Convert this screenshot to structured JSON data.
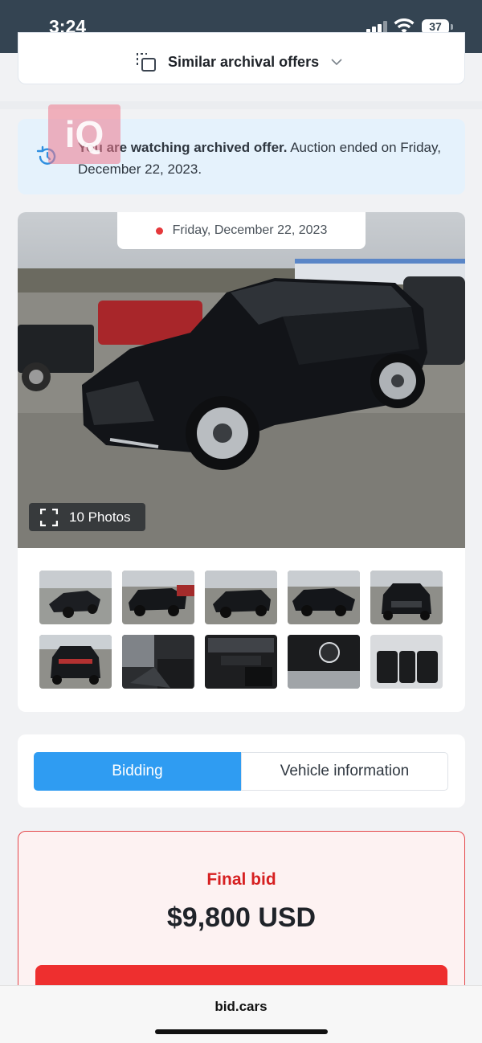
{
  "status_bar": {
    "time": "3:24",
    "battery": "37",
    "icons": [
      "signal-icon",
      "wifi-icon",
      "battery-icon"
    ]
  },
  "similar": {
    "label": "Similar archival offers",
    "icon": "copy-icon",
    "chevron": "chevron-down-icon"
  },
  "notice": {
    "bold_text": "You are watching archived offer.",
    "rest_text": " Auction ended on Friday, December 22, 2023.",
    "icon": "history-icon",
    "watermark": "iQ"
  },
  "photo": {
    "date": "Friday, December 22, 2023",
    "photos_count": "10 Photos",
    "thumbnails_count": 10
  },
  "tabs": {
    "bidding": "Bidding",
    "vehicle_info": "Vehicle information",
    "active": "Bidding"
  },
  "bid": {
    "label": "Final bid",
    "value": "$9,800 USD"
  },
  "browser": {
    "url": "bid.cars"
  },
  "colors": {
    "accent_blue": "#2f9cf2",
    "bid_red": "#d62021",
    "status_bar": "#344452",
    "notice_bg": "#e5f2fc"
  }
}
